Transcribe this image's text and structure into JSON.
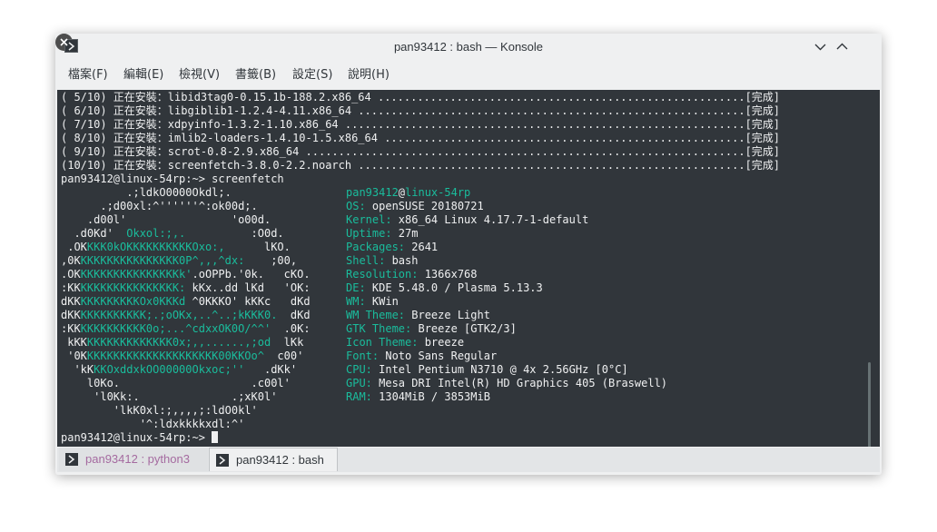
{
  "window": {
    "title": "pan93412 : bash — Konsole",
    "icons": {
      "app": "terminal-icon",
      "minimize": "chevron-down-icon",
      "maximize": "chevron-up-icon",
      "close": "close-icon"
    }
  },
  "menu": [
    "檔案(F)",
    "編輯(E)",
    "檢視(V)",
    "書籤(B)",
    "設定(S)",
    "說明(H)"
  ],
  "install_lines": [
    "( 5/10) 正在安裝：libid3tag0-0.15.1b-188.2.x86_64 ........................................................[完成]",
    "( 6/10) 正在安裝：libgiblib1-1.2.4-4.11.x86_64 ...........................................................[完成]",
    "( 7/10) 正在安裝：xdpyinfo-1.3.2-1.10.x86_64 .............................................................[完成]",
    "( 8/10) 正在安裝：imlib2-loaders-1.4.10-1.5.x86_64 .......................................................[完成]",
    "( 9/10) 正在安裝：scrot-0.8-2.9.x86_64 ...................................................................[完成]",
    "(10/10) 正在安裝：screenfetch-3.8.0-2.2.noarch ...........................................................[完成]"
  ],
  "command_line": "pan93412@linux-54rp:~> screenfetch",
  "logo": [
    {
      "w": "          .;ldkO0000Okdl;.",
      "g": "",
      "w2": ""
    },
    {
      "w": "      .;d00xl:^''''''^:ok00d;.",
      "g": "",
      "w2": ""
    },
    {
      "w": "    .d00l'                'o00d.",
      "g": "",
      "w2": ""
    },
    {
      "w": "  .d0Kd'  ",
      "g": "Okxol:;,.",
      "w2": "          :O0d."
    },
    {
      "w": " .OK",
      "g": "KKK0kOKKKKKKKKKKOxo:,",
      "w2": "      lKO."
    },
    {
      "w": ",0K",
      "g": "KKKKKKKKKKKKKKK0P^,,,^dx:",
      "w2": "    ;00,"
    },
    {
      "w": ".OK",
      "g": "KKKKKKKKKKKKKKKk'",
      "w2": ".oOPPb.'0k.   cKO."
    },
    {
      "w": ":KK",
      "g": "KKKKKKKKKKKKKKK:",
      "w2": " kKx..dd lKd   'OK:"
    },
    {
      "w": "dKK",
      "g": "KKKKKKKKKOx0KKKd",
      "w2": " ^0KKKO' kKKc   dKd"
    },
    {
      "w": "dKK",
      "g": "KKKKKKKKKK;.;oOKx,..^..;kKKK0.",
      "w2": "  dKd"
    },
    {
      "w": ":KK",
      "g": "KKKKKKKKKK0o;...^cdxxOK0O/^^'",
      "w2": "  .0K:"
    },
    {
      "w": " kKK",
      "g": "KKKKKKKKKKKKK0x;,,......,;od",
      "w2": "  lKk"
    },
    {
      "w": " '0K",
      "g": "KKKKKKKKKKKKKKKKKKKK00KKOo^",
      "w2": "  c00'"
    },
    {
      "w": "  'kK",
      "g": "KKOxddxkOO00000Okxoc;''",
      "w2": "   .dKk'"
    },
    {
      "w": "    l0Ko.",
      "g": "",
      "w2": "                    .c00l'"
    },
    {
      "w": "     'l0Kk:.              .;xK0l'",
      "g": "",
      "w2": ""
    },
    {
      "w": "        'lkK0xl:;,,,,;:ldO0kl'",
      "g": "",
      "w2": ""
    },
    {
      "w": "            '^:ldxkkkkxdl:^'",
      "g": "",
      "w2": ""
    }
  ],
  "sysinfo": {
    "user": "pan93412",
    "at": "@",
    "host": "linux-54rp",
    "rows": [
      {
        "key": "OS:",
        "value": " openSUSE 20180721"
      },
      {
        "key": "Kernel:",
        "value": " x86_64 Linux 4.17.7-1-default"
      },
      {
        "key": "Uptime:",
        "value": " 27m"
      },
      {
        "key": "Packages:",
        "value": " 2641"
      },
      {
        "key": "Shell:",
        "value": " bash"
      },
      {
        "key": "Resolution:",
        "value": " 1366x768"
      },
      {
        "key": "DE:",
        "value": " KDE 5.48.0 / Plasma 5.13.3"
      },
      {
        "key": "WM:",
        "value": " KWin"
      },
      {
        "key": "WM Theme:",
        "value": " Breeze Light"
      },
      {
        "key": "GTK Theme:",
        "value": " Breeze [GTK2/3]"
      },
      {
        "key": "Icon Theme:",
        "value": " breeze"
      },
      {
        "key": "Font:",
        "value": " Noto Sans Regular"
      },
      {
        "key": "CPU:",
        "value": " Intel Pentium N3710 @ 4x 2.56GHz [0°C]"
      },
      {
        "key": "GPU:",
        "value": " Mesa DRI Intel(R) HD Graphics 405 (Braswell)"
      },
      {
        "key": "RAM:",
        "value": " 1304MiB / 3853MiB"
      }
    ]
  },
  "prompt": "pan93412@linux-54rp:~> ",
  "tabs": [
    {
      "label": "pan93412 : python3",
      "active": false
    },
    {
      "label": "pan93412 : bash",
      "active": true
    }
  ],
  "colors": {
    "accent": "#1abc9c",
    "terminal_bg": "#31363b",
    "terminal_fg": "#eff0f1",
    "tab_inactive_text": "#a56ba0"
  }
}
